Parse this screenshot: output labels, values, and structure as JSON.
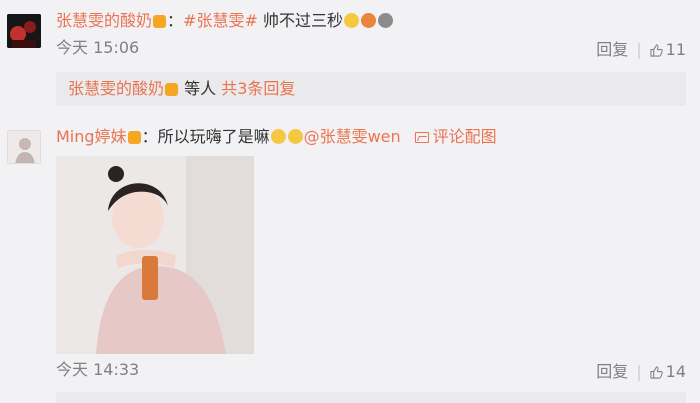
{
  "comments": [
    {
      "username": "张慧雯的酸奶",
      "hashtag": "#张慧雯#",
      "text": "帅不过三秒",
      "time": "今天 15:06",
      "reply_label": "回复",
      "like_count": "11",
      "replies_preview": {
        "name": "张慧雯的酸奶",
        "others": "等人",
        "total": "共3条回复"
      }
    },
    {
      "username": "Ming婷妹",
      "text": "所以玩嗨了是嘛",
      "mention": "@张慧雯wen",
      "image_comment_label": "评论配图",
      "time": "今天 14:33",
      "reply_label": "回复",
      "like_count": "14"
    }
  ],
  "colors": {
    "accent": "#eb7350",
    "meta": "#808080",
    "background": "#f2f2f5",
    "subbox": "#eaeaec"
  },
  "icons": [
    "vip-badge-icon",
    "smile-emoji-icon",
    "tiger-emoji-icon",
    "cat-emoji-icon",
    "like-thumb-icon",
    "image-icon"
  ]
}
